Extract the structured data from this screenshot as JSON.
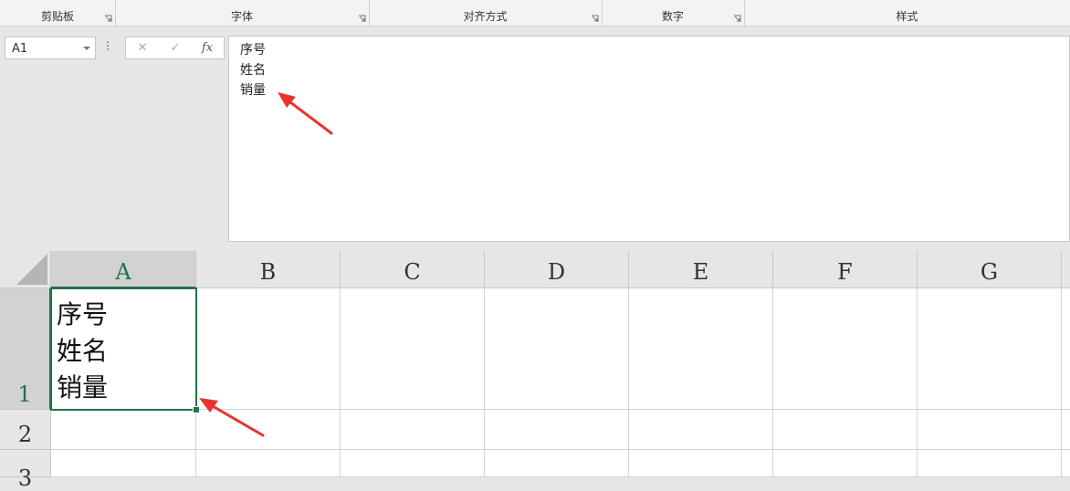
{
  "ribbon": {
    "groups": [
      {
        "label": "剪贴板"
      },
      {
        "label": "字体"
      },
      {
        "label": "对齐方式"
      },
      {
        "label": "数字"
      },
      {
        "label": "样式"
      }
    ]
  },
  "name_box": {
    "value": "A1"
  },
  "formula_bar": {
    "cancel_icon": "✕",
    "enter_icon": "✓",
    "insert_function_label": "fx",
    "lines": [
      "序号",
      "姓名",
      "销量"
    ]
  },
  "grid": {
    "columns": [
      "A",
      "B",
      "C",
      "D",
      "E",
      "F",
      "G"
    ],
    "rows": [
      "1",
      "2",
      "3"
    ],
    "selected_cell": "A1",
    "cells": {
      "A1": [
        "序号",
        "姓名",
        "销量"
      ]
    }
  },
  "colors": {
    "accent": "#217346",
    "annotation_arrow": "#e8342f"
  }
}
